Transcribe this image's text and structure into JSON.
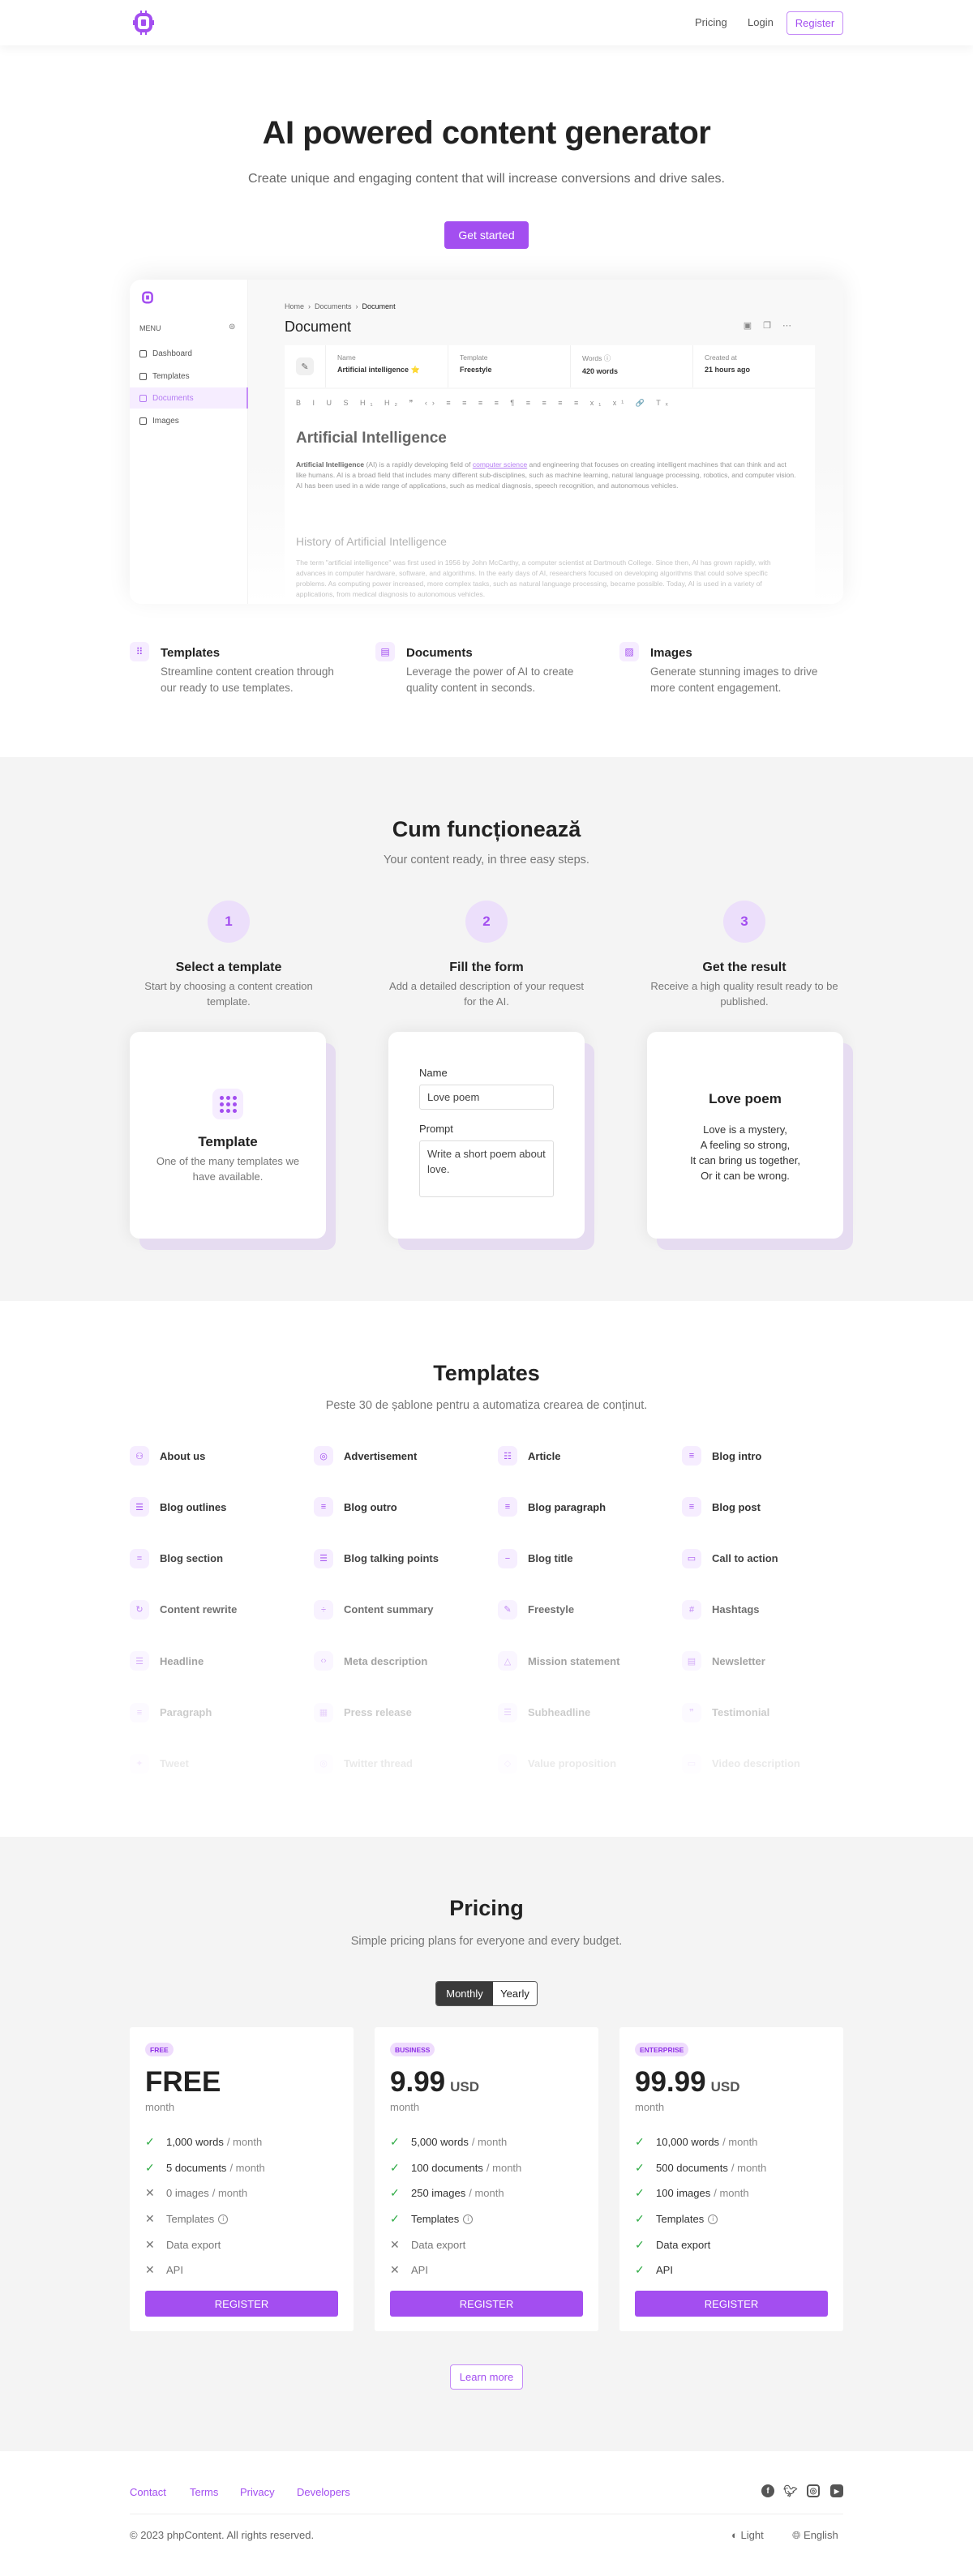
{
  "colors": {
    "accent": "#a34ef0",
    "accent_light": "#f6edff",
    "success": "#2eab45"
  },
  "nav": {
    "logo": "chip-logo",
    "links": [
      "Pricing",
      "Login"
    ],
    "register": "Register"
  },
  "hero": {
    "title": "AI powered content generator",
    "subtitle": "Create unique and engaging content that will increase conversions and drive sales.",
    "cta": "Get started"
  },
  "mockup": {
    "menu_label": "MENU",
    "sidebar": [
      "Dashboard",
      "Templates",
      "Documents",
      "Images"
    ],
    "active": "Documents",
    "breadcrumb": [
      "Home",
      "Documents",
      "Document"
    ],
    "title": "Document",
    "info": [
      {
        "label": "Name",
        "value": "Artificial intelligence ⭐"
      },
      {
        "label": "Template",
        "value": "Freestyle"
      },
      {
        "label": "Words ⓘ",
        "value": "420 words"
      },
      {
        "label": "Created at",
        "value": "21 hours ago"
      }
    ],
    "toolbar": "B I U S  H₁ H₂ ❞ ‹›  ≡ ≡ ≡ ≡  ¶ ≡ ≡ ≡ ≡  x₁ x¹  🔗 Tₓ",
    "heading": "Artificial Intelligence",
    "para_bold": "Artificial Intelligence",
    "para_1": " (AI) is a rapidly developing field of ",
    "para_link": "computer science",
    "para_2": " and engineering that focuses on creating intelligent machines that can think and act like humans. AI is a broad field that includes many different sub-disciplines, such as machine learning, natural language processing, robotics, and computer vision. AI has been used in a wide range of applications, such as medical diagnosis, speech recognition, and autonomous vehicles.",
    "heading2": "History of Artificial Intelligence",
    "para2": "The term \"artificial intelligence\" was first used in 1956 by John McCarthy, a computer scientist at Dartmouth College. Since then, AI has grown rapidly, with advances in computer hardware, software, and algorithms. In the early days of AI, researchers focused on developing algorithms that could solve specific problems. As computing power increased, more complex tasks, such as natural language processing, became possible. Today, AI is used in a variety of applications, from medical diagnosis to autonomous vehicles."
  },
  "features": [
    {
      "icon": "grid-icon",
      "title": "Templates",
      "desc": "Streamline content creation through our ready to use templates."
    },
    {
      "icon": "document-icon",
      "title": "Documents",
      "desc": "Leverage the power of AI to create quality content in seconds."
    },
    {
      "icon": "image-icon",
      "title": "Images",
      "desc": "Generate stunning images to drive more content engagement."
    }
  ],
  "how": {
    "title": "Cum funcționează",
    "subtitle": "Your content ready, in three easy steps.",
    "steps": [
      {
        "num": "1",
        "title": "Select a template",
        "desc": "Start by choosing a content creation template."
      },
      {
        "num": "2",
        "title": "Fill the form",
        "desc": "Add a detailed description of your request for the AI."
      },
      {
        "num": "3",
        "title": "Get the result",
        "desc": "Receive a high quality result ready to be published."
      }
    ],
    "card1": {
      "title": "Template",
      "desc": "One of the many templates we have available."
    },
    "card2": {
      "name_label": "Name",
      "name_value": "Love poem",
      "prompt_label": "Prompt",
      "prompt_value": "Write a short poem about love."
    },
    "card3": {
      "title": "Love poem",
      "lines": [
        "Love is a mystery,",
        "A feeling so strong,",
        "It can bring us together,",
        "Or it can be wrong."
      ]
    }
  },
  "templates": {
    "title": "Templates",
    "subtitle": "Peste 30 de șablone pentru a automatiza crearea de conținut.",
    "items": [
      "About us",
      "Advertisement",
      "Article",
      "Blog intro",
      "Blog outlines",
      "Blog outro",
      "Blog paragraph",
      "Blog post",
      "Blog section",
      "Blog talking points",
      "Blog title",
      "Call to action",
      "Content rewrite",
      "Content summary",
      "Freestyle",
      "Hashtags",
      "Headline",
      "Meta description",
      "Mission statement",
      "Newsletter",
      "Paragraph",
      "Press release",
      "Subheadline",
      "Testimonial",
      "Tweet",
      "Twitter thread",
      "Value proposition",
      "Video description"
    ]
  },
  "pricing": {
    "title": "Pricing",
    "subtitle": "Simple pricing plans for everyone and every budget.",
    "toggle": [
      "Monthly",
      "Yearly"
    ],
    "toggle_selected": "Monthly",
    "plans": [
      {
        "badge": "FREE",
        "price": "FREE",
        "currency": "",
        "period": "month",
        "button": "REGISTER",
        "features": [
          {
            "main": "1,000 words",
            "suffix": "/ month",
            "included": true
          },
          {
            "main": "5 documents",
            "suffix": "/ month",
            "included": true
          },
          {
            "main": "0 images",
            "suffix": "/ month",
            "included": false
          },
          {
            "main": "Templates",
            "suffix": "",
            "included": false,
            "info": true
          },
          {
            "main": "Data export",
            "suffix": "",
            "included": false
          },
          {
            "main": "API",
            "suffix": "",
            "included": false
          }
        ]
      },
      {
        "badge": "BUSINESS",
        "price": "9.99",
        "currency": "USD",
        "period": "month",
        "button": "REGISTER",
        "features": [
          {
            "main": "5,000 words",
            "suffix": "/ month",
            "included": true
          },
          {
            "main": "100 documents",
            "suffix": "/ month",
            "included": true
          },
          {
            "main": "250 images",
            "suffix": "/ month",
            "included": true
          },
          {
            "main": "Templates",
            "suffix": "",
            "included": true,
            "info": true
          },
          {
            "main": "Data export",
            "suffix": "",
            "included": false
          },
          {
            "main": "API",
            "suffix": "",
            "included": false
          }
        ]
      },
      {
        "badge": "ENTERPRISE",
        "price": "99.99",
        "currency": "USD",
        "period": "month",
        "button": "REGISTER",
        "features": [
          {
            "main": "10,000 words",
            "suffix": "/ month",
            "included": true
          },
          {
            "main": "500 documents",
            "suffix": "/ month",
            "included": true
          },
          {
            "main": "100 images",
            "suffix": "/ month",
            "included": true
          },
          {
            "main": "Templates",
            "suffix": "",
            "included": true,
            "info": true
          },
          {
            "main": "Data export",
            "suffix": "",
            "included": true
          },
          {
            "main": "API",
            "suffix": "",
            "included": true
          }
        ]
      }
    ],
    "learn_more": "Learn more"
  },
  "footer": {
    "links": [
      "Contact",
      "Terms",
      "Privacy",
      "Developers"
    ],
    "social": [
      "facebook-icon",
      "twitter-icon",
      "instagram-icon",
      "youtube-icon"
    ],
    "copyright": "© 2023 phpContent. All rights reserved.",
    "theme": "Light",
    "language": "English"
  }
}
